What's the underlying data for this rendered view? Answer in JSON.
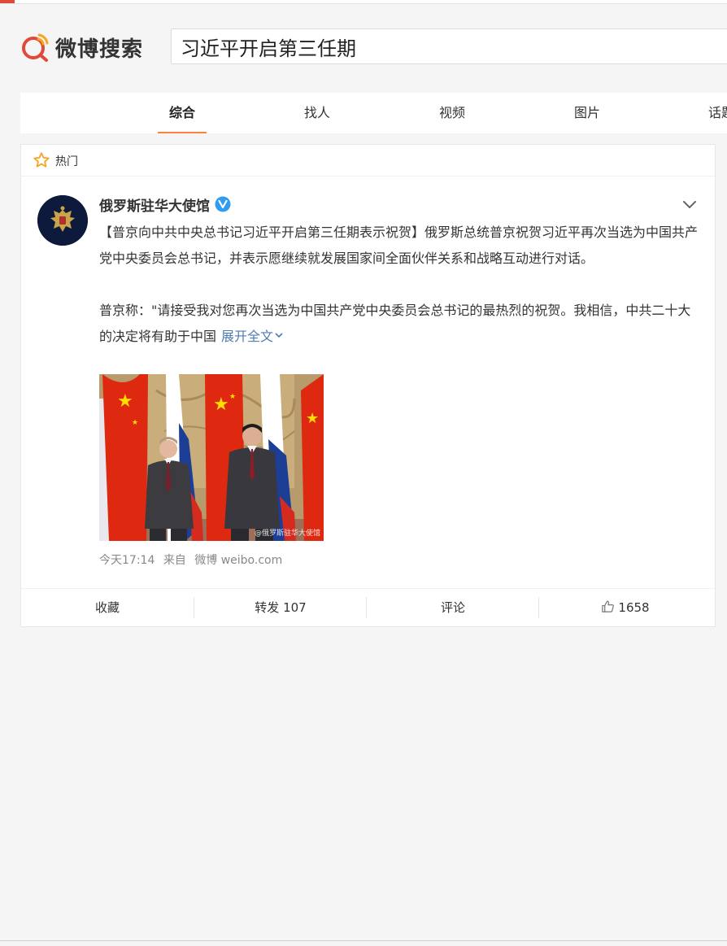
{
  "app": {
    "logo_text": "微博搜索",
    "brand_color": "#e04a3a",
    "accent_color": "#ff8140",
    "link_color": "#507daf"
  },
  "search": {
    "value": "习近平开启第三任期",
    "placeholder": ""
  },
  "tabs": [
    {
      "label": "综合",
      "active": true
    },
    {
      "label": "找人",
      "active": false
    },
    {
      "label": "视频",
      "active": false
    },
    {
      "label": "图片",
      "active": false
    },
    {
      "label": "话题",
      "active": false
    }
  ],
  "card": {
    "header_icon": "star-icon",
    "header_label": "热门"
  },
  "post": {
    "author": "俄罗斯驻华大使馆",
    "verified_icon": "verified-badge-icon",
    "paragraph1": "【普京向中共中央总书记习近平开启第三任期表示祝贺】俄罗斯总统普京祝贺习近平再次当选为中国共产党中央委员会总书记，并表示愿继续就发展国家间全面伙伴关系和战略互动进行对话。",
    "paragraph2": "普京称：\"请接受我对您再次当选为中国共产党中央委员会总书记的最热烈的祝贺。我相信，中共二十大的决定将有助于中国",
    "expand_label": "展开全文",
    "image_watermark": "@俄罗斯驻华大使馆",
    "meta": {
      "time": "今天17:14",
      "source_prefix": "来自",
      "source": "微博 weibo.com"
    }
  },
  "actions": {
    "favorite_label": "收藏",
    "repost_label": "转发 107",
    "comment_label": "评论",
    "like_count": "1658"
  }
}
